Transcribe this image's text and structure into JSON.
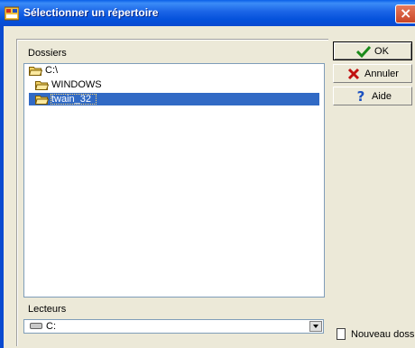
{
  "window": {
    "title": "Sélectionner un répertoire",
    "close_label": "×"
  },
  "folders": {
    "label": "Dossiers",
    "items": [
      "C:\\",
      "WINDOWS",
      "twain_32"
    ],
    "selected": "twain_32"
  },
  "drives": {
    "label": "Lecteurs",
    "selected_value": "C:"
  },
  "buttons": {
    "ok": "OK",
    "cancel": "Annuler",
    "help": "Aide",
    "new_folder": "Nouveau dossi"
  },
  "colors": {
    "selection": "#316ac5",
    "titlebar": "#0a5fe8",
    "folder_yellow": "#f3d266"
  }
}
